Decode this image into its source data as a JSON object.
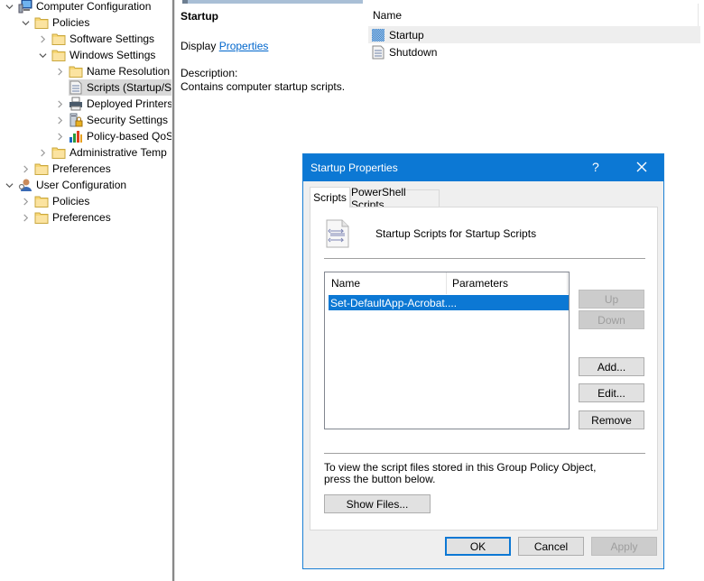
{
  "tree": {
    "items": [
      {
        "label": "Computer Configuration",
        "icon": "computer-config-icon",
        "expander": "expanded"
      },
      {
        "label": "Policies",
        "icon": "folder-icon",
        "expander": "expanded"
      },
      {
        "label": "Software Settings",
        "icon": "folder-icon",
        "expander": "collapsed"
      },
      {
        "label": "Windows Settings",
        "icon": "folder-icon",
        "expander": "expanded"
      },
      {
        "label": "Name Resolution",
        "icon": "folder-icon",
        "expander": "collapsed"
      },
      {
        "label": "Scripts (Startup/S",
        "icon": "script-icon",
        "expander": "none",
        "selected": true
      },
      {
        "label": "Deployed Printers",
        "icon": "printer-icon",
        "expander": "collapsed"
      },
      {
        "label": "Security Settings",
        "icon": "security-icon",
        "expander": "collapsed"
      },
      {
        "label": "Policy-based QoS",
        "icon": "qos-chart-icon",
        "expander": "collapsed"
      },
      {
        "label": "Administrative Temp",
        "icon": "folder-icon",
        "expander": "collapsed"
      },
      {
        "label": "Preferences",
        "icon": "folder-icon",
        "expander": "collapsed"
      },
      {
        "label": "User Configuration",
        "icon": "user-config-icon",
        "expander": "expanded"
      },
      {
        "label": "Policies",
        "icon": "folder-icon",
        "expander": "collapsed"
      },
      {
        "label": "Preferences",
        "icon": "folder-icon",
        "expander": "collapsed"
      }
    ]
  },
  "description": {
    "title": "Startup",
    "display_prefix": "Display",
    "display_link": "Properties",
    "label": "Description:",
    "text": "Contains computer startup scripts."
  },
  "list": {
    "column": "Name",
    "rows": [
      {
        "label": "Startup",
        "icon": "startup-script-icon",
        "highlighted": true
      },
      {
        "label": "Shutdown",
        "icon": "shutdown-script-icon",
        "highlighted": false
      }
    ]
  },
  "dialog": {
    "title": "Startup Properties",
    "help": "?",
    "tabs": [
      "Scripts",
      "PowerShell Scripts"
    ],
    "active_tab": "Scripts",
    "header_text": "Startup Scripts for Startup Scripts",
    "table": {
      "columns": [
        "Name",
        "Parameters"
      ],
      "rows": [
        {
          "name": "Set-DefaultApp-Acrobat....",
          "parameters": "",
          "selected": true
        }
      ]
    },
    "buttons": {
      "up": "Up",
      "down": "Down",
      "add": "Add...",
      "edit": "Edit...",
      "remove": "Remove",
      "show_files": "Show Files...",
      "ok": "OK",
      "cancel": "Cancel",
      "apply": "Apply"
    },
    "info_text": "To view the script files stored in this Group Policy Object, press the button below."
  },
  "colors": {
    "accent": "#0c78d4",
    "link": "#0066cc",
    "selection": "#d9d9d9"
  }
}
